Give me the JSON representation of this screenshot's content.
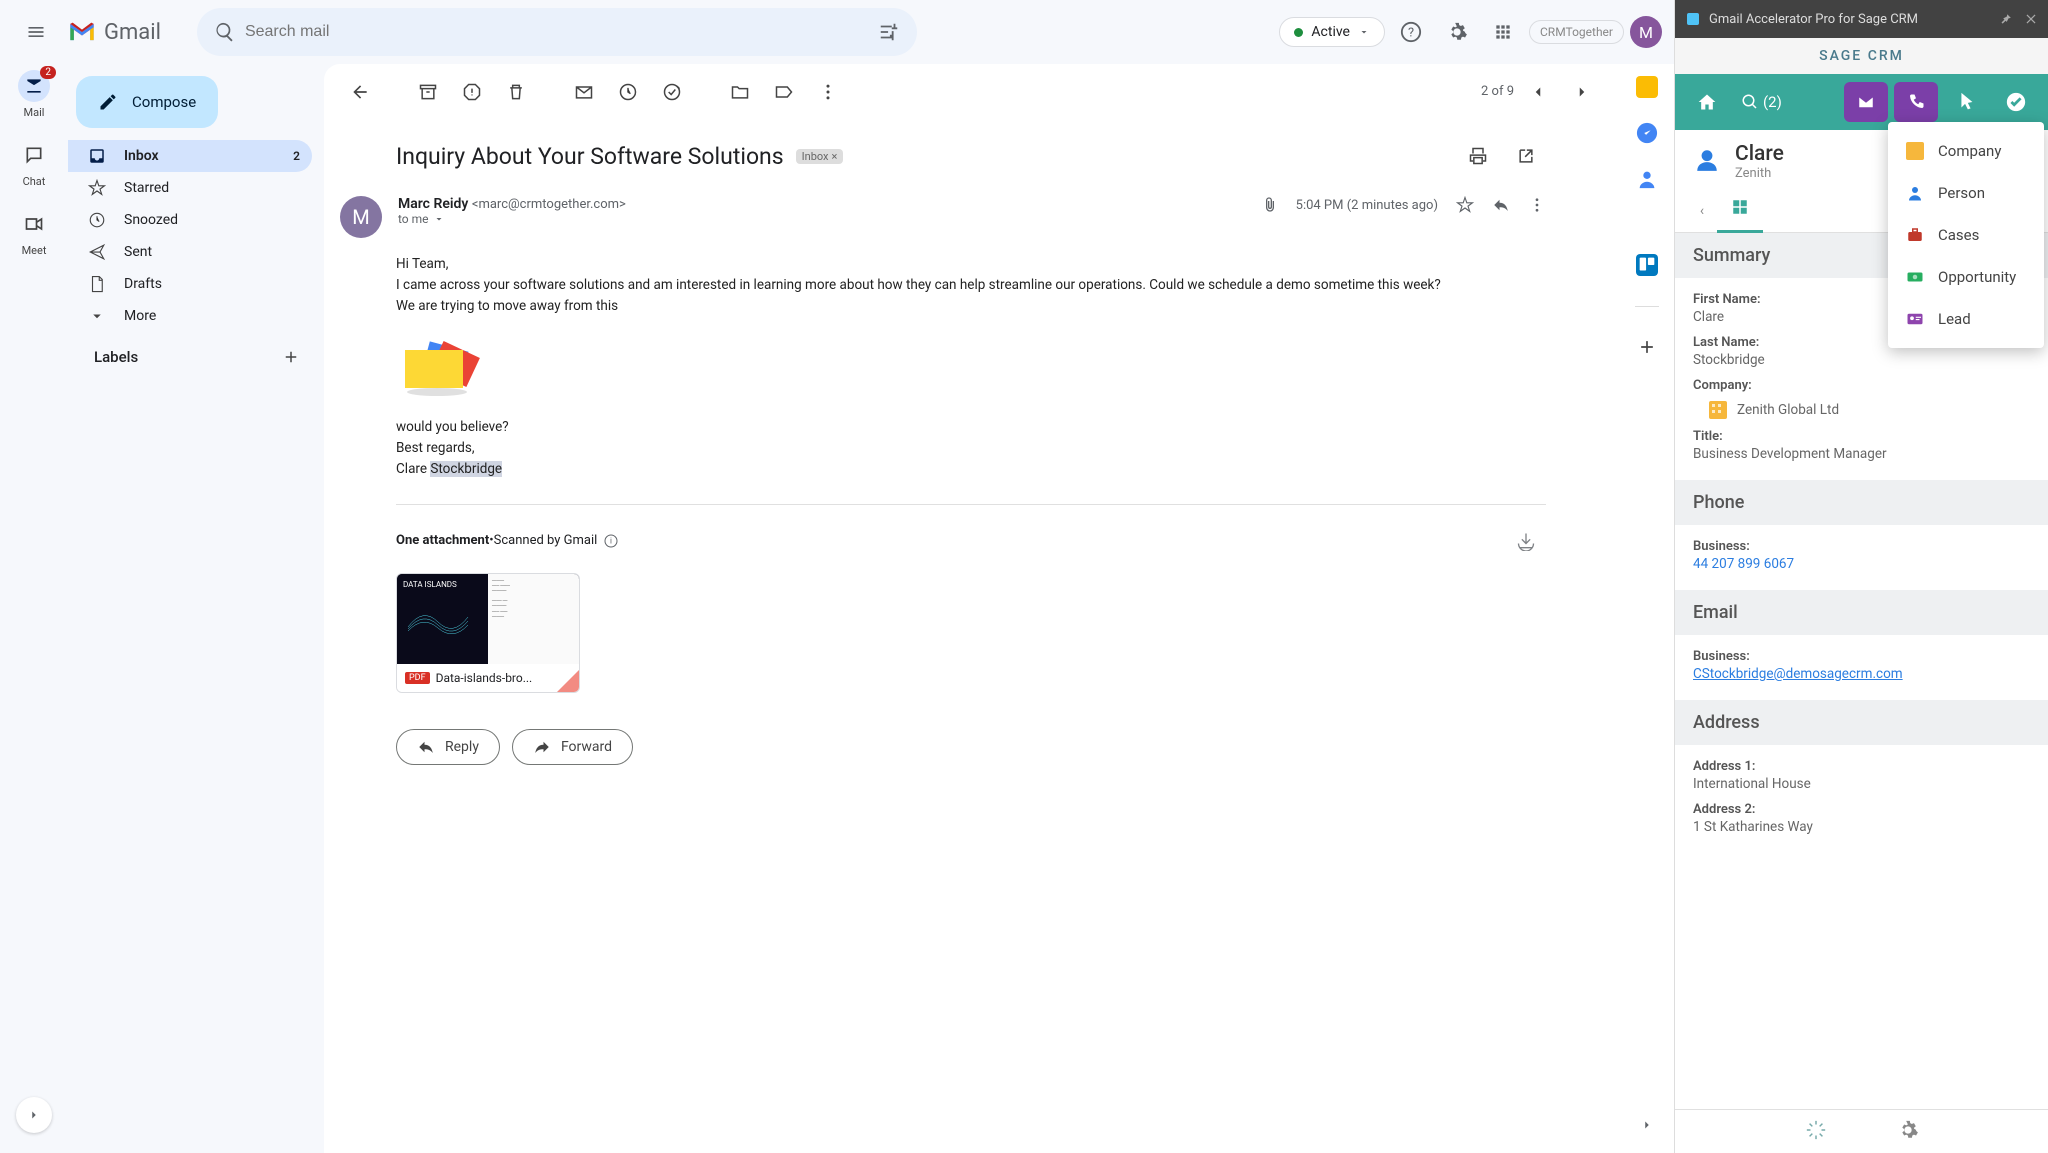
{
  "header": {
    "gmail_text": "Gmail",
    "search_placeholder": "Search mail",
    "active_label": "Active",
    "avatar_letter": "M",
    "crm_logo": "CRMTogether"
  },
  "rail": {
    "mail": "Mail",
    "chat": "Chat",
    "meet": "Meet",
    "badge": "2"
  },
  "sidebar": {
    "compose": "Compose",
    "inbox": "Inbox",
    "inbox_count": "2",
    "starred": "Starred",
    "snoozed": "Snoozed",
    "sent": "Sent",
    "drafts": "Drafts",
    "more": "More",
    "labels": "Labels"
  },
  "pager": "2 of 9",
  "email": {
    "subject": "Inquiry About Your Software Solutions",
    "inbox_chip": "Inbox",
    "sender_name": "Marc Reidy",
    "sender_email": "<marc@crmtogether.com>",
    "to_line": "to me",
    "time": "5:04 PM (2 minutes ago)",
    "line1": "Hi Team,",
    "line2": "I came across your software solutions and am interested in learning more about how they can help streamline our operations. Could we schedule a demo sometime this week?",
    "line3": "We are trying to move away from this",
    "line4": "would you believe?",
    "line5": "Best regards,",
    "signer_first": "Clare ",
    "signer_last": "Stockbridge",
    "attach_count": "One attachment",
    "dot": " • ",
    "scanned": "Scanned by Gmail",
    "attach_name": "Data-islands-bro...",
    "reply": "Reply",
    "forward": "Forward",
    "avatar_letter": "M"
  },
  "crm": {
    "ext_title": "Gmail Accelerator Pro for Sage CRM",
    "brand": "SAGE CRM",
    "search_count": "(2)",
    "dropdown": {
      "company": "Company",
      "person": "Person",
      "cases": "Cases",
      "opportunity": "Opportunity",
      "lead": "Lead"
    },
    "contact_name": "Clare",
    "contact_company_short": "Zenith",
    "summary": "Summary",
    "fields": {
      "first_name_label": "First Name:",
      "first_name": "Clare",
      "last_name_label": "Last Name:",
      "last_name": "Stockbridge",
      "company_label": "Company:",
      "company": "Zenith Global Ltd",
      "title_label": "Title:",
      "title": "Business Development Manager"
    },
    "phone_hdr": "Phone",
    "phone_label": "Business:",
    "phone_value": "44 207 899 6067",
    "email_hdr": "Email",
    "email_label": "Business:",
    "email_value": "CStockbridge@demosagecrm.com",
    "address_hdr": "Address",
    "addr1_label": "Address 1:",
    "addr1": "International House",
    "addr2_label": "Address 2:",
    "addr2": "1 St Katharines Way"
  }
}
